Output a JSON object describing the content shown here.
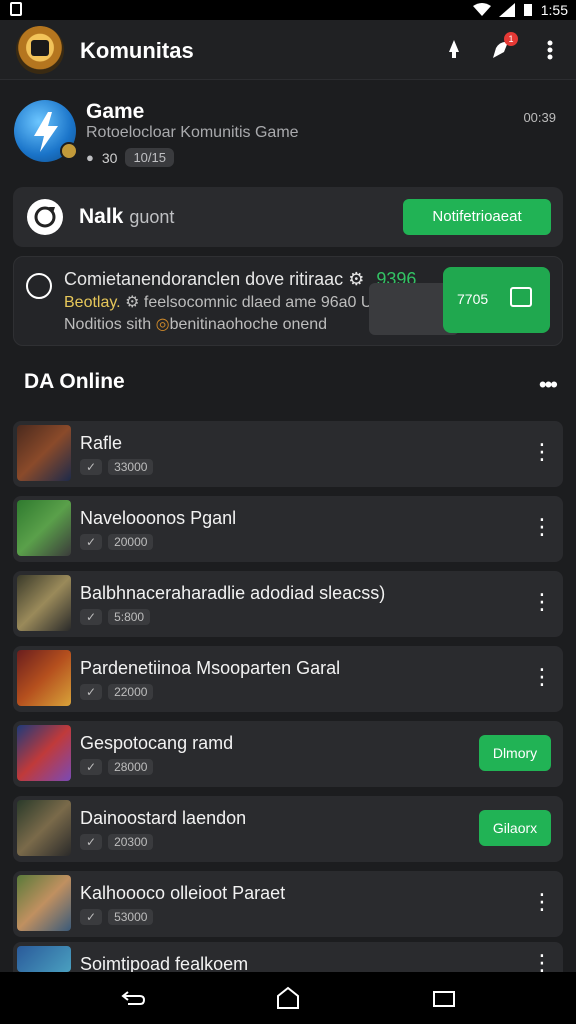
{
  "status": {
    "time": "1:55"
  },
  "appbar": {
    "title": "Komunitas",
    "notif_count": "1"
  },
  "game": {
    "title": "Game",
    "subtitle": "Rotoelocloar Komunitis Game",
    "chip1": "30",
    "chip2": "10/15",
    "time": "00:39"
  },
  "notif": {
    "label": "Nalk",
    "label2": "guont",
    "button": "Notifetrioaeat"
  },
  "message": {
    "line1": "Comietanendoranclen dove ritiraac",
    "line1_value": "9396",
    "line2_a": "Beotlay.",
    "line2_b": "feelsocomnic dlaed ame 96a0 Urbrotraro",
    "line3": "Noditios sith",
    "line3_b": "benitinaohoche onend",
    "button_value": "7705"
  },
  "section": {
    "title": "DA Online"
  },
  "players": [
    {
      "name": "Rafle",
      "tag": "33000",
      "action": "more"
    },
    {
      "name": "Navelooonos Pganl",
      "tag": "20000",
      "action": "more"
    },
    {
      "name": "Balbhnaceraharadlie adodiad sleacss)",
      "tag": "5:800",
      "action": "more"
    },
    {
      "name": "Pardenetiinoa Msooparten Garal",
      "tag": "22000",
      "action": "more"
    },
    {
      "name": "Gespotocang ramd",
      "tag": "28000",
      "action": "join",
      "join_label": "Dlmory"
    },
    {
      "name": "Dainoostard laendon",
      "tag": "20300",
      "action": "join",
      "join_label": "Gilaorx"
    },
    {
      "name": "Kalhoooco olleioot Paraet",
      "tag": "53000",
      "action": "more"
    },
    {
      "name": "Soimtipoad fealkoem",
      "tag": "",
      "action": "more"
    }
  ],
  "colors": {
    "accent": "#21b355",
    "card": "#2a2b2e",
    "bg": "#1c1d1f"
  }
}
